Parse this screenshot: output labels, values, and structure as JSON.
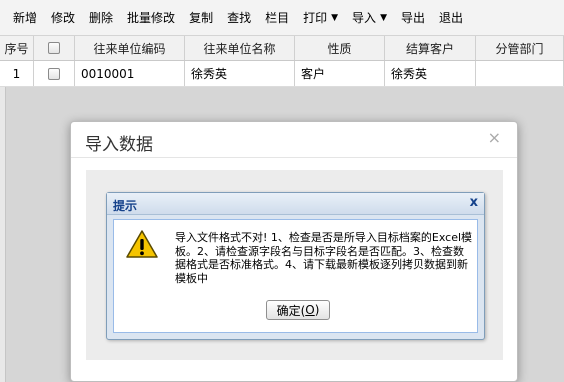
{
  "toolbar": {
    "items": [
      {
        "label": "新增"
      },
      {
        "label": "修改"
      },
      {
        "label": "删除"
      },
      {
        "label": "批量修改"
      },
      {
        "label": "复制"
      },
      {
        "label": "查找"
      },
      {
        "label": "栏目"
      },
      {
        "label": "打印",
        "dropdown": true
      },
      {
        "label": "导入",
        "dropdown": true
      },
      {
        "label": "导出"
      },
      {
        "label": "退出"
      }
    ]
  },
  "grid": {
    "columns": [
      "序号",
      "",
      "往来单位编码",
      "往来单位名称",
      "性质",
      "结算客户",
      "分管部门"
    ],
    "rows": [
      {
        "index": "1",
        "code": "0010001",
        "name": "徐秀英",
        "type": "客户",
        "settle": "徐秀英",
        "dept": ""
      }
    ]
  },
  "dialog": {
    "title": "导入数据",
    "close_icon": "×"
  },
  "alert": {
    "title": "提示",
    "close_icon": "x",
    "icon": "warning-icon",
    "message": "导入文件格式不对! 1、检查是否是所导入目标档案的Excel模板。2、请检查源字段名与目标字段名是否匹配。3、检查数据格式是否标准格式。4、请下载最新模板逐列拷贝数据到新模板中",
    "ok_label": "确定(",
    "ok_key": "O",
    "ok_suffix": ")"
  },
  "colors": {
    "alert_title": "#15428b",
    "warning_fill": "#f5c400"
  }
}
